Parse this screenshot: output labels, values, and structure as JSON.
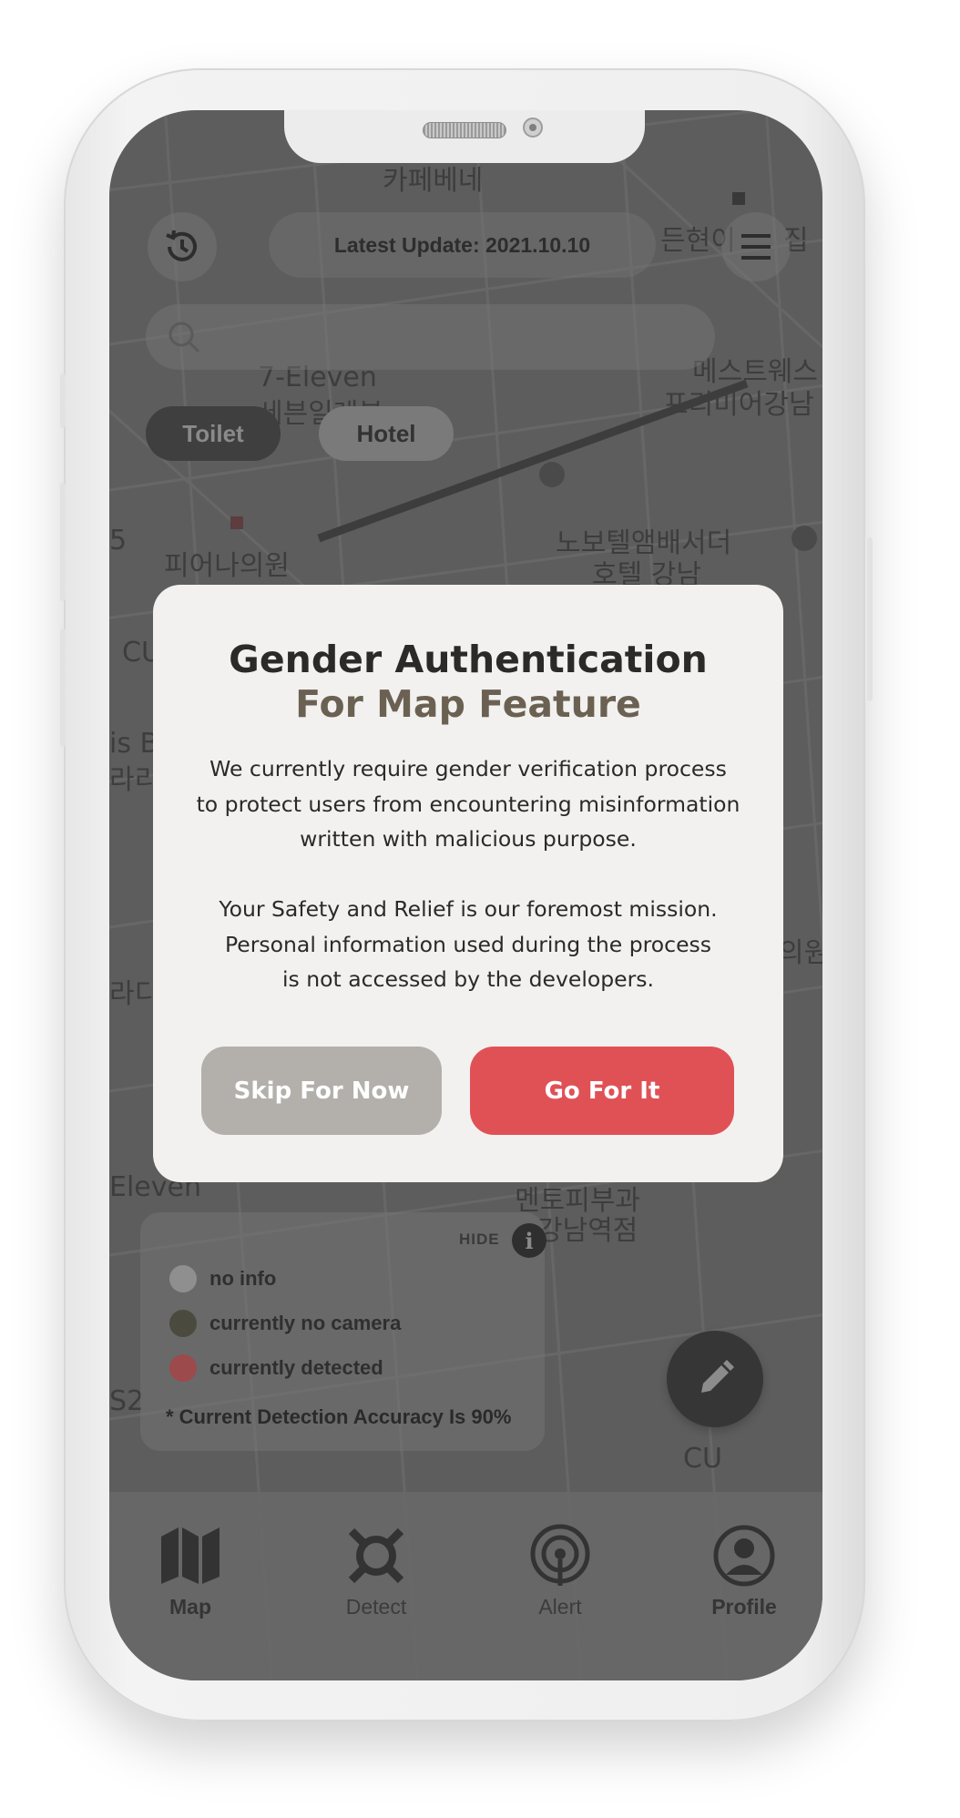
{
  "header": {
    "latest_update": "Latest Update: 2021.10.10"
  },
  "filters": {
    "toilet": "Toilet",
    "hotel": "Hotel"
  },
  "map_labels": [
    "카페베네",
    "7-Eleven",
    "세븐일레븐",
    "피어나의원",
    "노보텔앰배서더",
    "호텔 강남",
    "메스트웨스",
    "프리미어강남",
    "Eleven",
    "멘토피부과",
    "강남역점",
    "CU",
    "CU",
    "S2",
    "라디",
    "is B",
    "라리",
    "의원",
    "5",
    "든현이",
    "집"
  ],
  "modal": {
    "title_line1": "Gender Authentication",
    "title_line2": "For Map Feature",
    "paragraph1": [
      "We currently require gender verification process",
      "to protect users from encountering misinformation",
      "written with malicious purpose."
    ],
    "paragraph2": [
      "Your Safety and Relief is our foremost mission.",
      "Personal information used during the process",
      "is not accessed by the developers."
    ],
    "skip_label": "Skip For Now",
    "go_label": "Go For It"
  },
  "legend": {
    "hide_label": "HIDE",
    "items": [
      {
        "label": "no info",
        "color": "#8f8f8f"
      },
      {
        "label": "currently no camera",
        "color": "#4a4a3e"
      },
      {
        "label": "currently detected",
        "color": "#9c4a4c"
      }
    ],
    "accuracy_note": "* Current Detection Accuracy Is 90%"
  },
  "nav": {
    "items": [
      {
        "label": "Map",
        "icon": "map-icon",
        "active": true
      },
      {
        "label": "Detect",
        "icon": "detect-icon",
        "active": false
      },
      {
        "label": "Alert",
        "icon": "alert-icon",
        "active": false
      },
      {
        "label": "Profile",
        "icon": "profile-icon",
        "active": false
      }
    ]
  },
  "colors": {
    "primary_button": "#e05156",
    "secondary_button": "#b3b0ab",
    "modal_background": "#f2f1f0",
    "title_accent": "#6b6152"
  }
}
